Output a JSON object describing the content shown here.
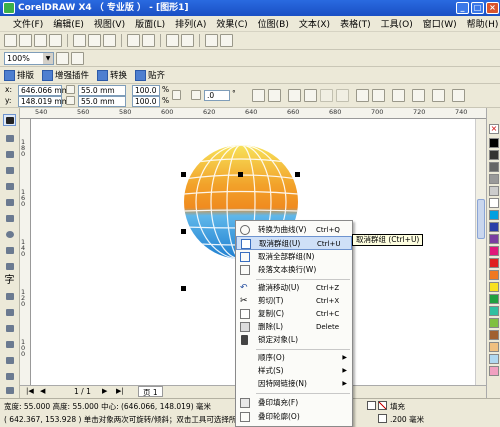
{
  "window": {
    "title": "CorelDRAW X4 （ 专业版 ） - [图形1]"
  },
  "menu": [
    "文件(F)",
    "编辑(E)",
    "视图(V)",
    "版面(L)",
    "排列(A)",
    "效果(C)",
    "位图(B)",
    "文本(X)",
    "表格(T)",
    "工具(O)",
    "窗口(W)",
    "帮助(H)"
  ],
  "standard_toolbar": {
    "zoom": "100%"
  },
  "plugin_toolbar": {
    "items": [
      "排版",
      "增强插件",
      "转换",
      "贴齐"
    ]
  },
  "property_bar": {
    "x_label": "x:",
    "x_value": "646.066 mm",
    "y_label": "y:",
    "y_value": "148.019 mm",
    "w_value": "55.0 mm",
    "h_value": "55.0 mm",
    "scale_x": "100.0",
    "scale_y": "100.0",
    "pct": "%",
    "angle": ".0",
    "degree": "°"
  },
  "ruler": {
    "h_ticks": [
      "540",
      "560",
      "580",
      "600",
      "620",
      "640",
      "660",
      "680",
      "700",
      "720",
      "740"
    ],
    "v_ticks": [
      "1 8 0",
      "1 6 0",
      "1 4 0",
      "1 2 0",
      "1 0 0"
    ]
  },
  "context_menu": {
    "items": [
      {
        "label": "转换为曲线(V)",
        "shortcut": "Ctrl+Q",
        "icon": "convert-curve-icon"
      },
      {
        "label": "取消群组(U)",
        "shortcut": "Ctrl+U",
        "icon": "ungroup-icon",
        "highlight": true
      },
      {
        "label": "取消全部群组(N)",
        "shortcut": "",
        "icon": "ungroup-all-icon"
      },
      {
        "label": "段落文本换行(W)",
        "shortcut": "",
        "icon": "text-wrap-icon"
      },
      {
        "label": "撤消移动(U)",
        "shortcut": "Ctrl+Z",
        "icon": "undo-icon"
      },
      {
        "label": "剪切(T)",
        "shortcut": "Ctrl+X",
        "icon": "cut-icon"
      },
      {
        "label": "复制(C)",
        "shortcut": "Ctrl+C",
        "icon": "copy-icon"
      },
      {
        "label": "删除(L)",
        "shortcut": "Delete",
        "icon": "delete-icon"
      },
      {
        "label": "锁定对象(L)",
        "shortcut": "",
        "icon": "lock-icon"
      },
      {
        "label": "顺序(O)",
        "shortcut": "",
        "submenu": true
      },
      {
        "label": "样式(S)",
        "shortcut": "",
        "submenu": true
      },
      {
        "label": "因特网链接(N)",
        "shortcut": "",
        "submenu": true
      },
      {
        "label": "叠印填充(F)",
        "shortcut": "",
        "icon": "overprint-fill-icon"
      },
      {
        "label": "叠印轮廓(O)",
        "shortcut": "",
        "icon": "overprint-outline-icon"
      }
    ],
    "tooltip": "取消群组 (Ctrl+U)"
  },
  "page_nav": {
    "page_count": "1 / 1",
    "page_tab": "页 1"
  },
  "status": {
    "line1": "宽度: 55.000 高度: 55.000 中心: (646.066, 148.019) 毫米",
    "line2": "( 642.367, 153.928 )    单击对象两次可旋转/倾斜；双击工具可选择所有对",
    "fill_label": "填充",
    "outline_value": ".200 毫米"
  },
  "colors": {
    "titlebar": "#1a4fc4",
    "menu_highlight": "#cfe0f7"
  }
}
